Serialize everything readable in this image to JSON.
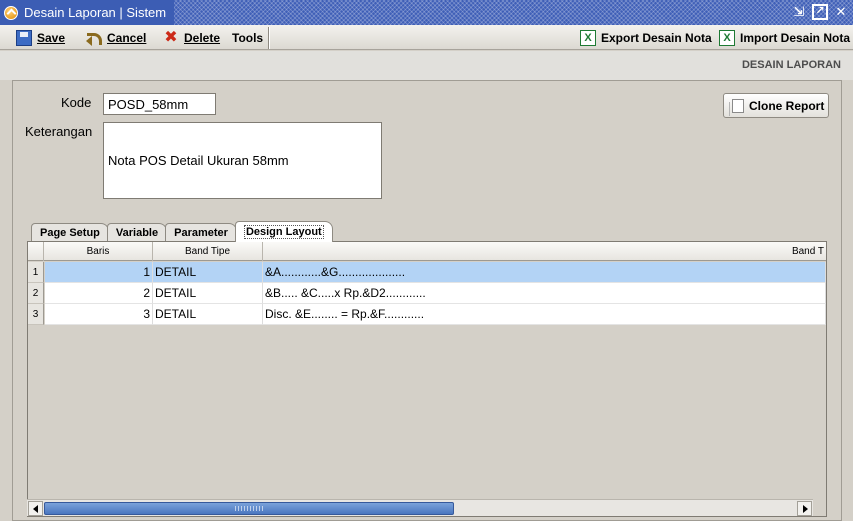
{
  "window": {
    "title": "Desain Laporan | Sistem",
    "icons": [
      "app-logo-icon",
      "minimize-icon",
      "maximize-icon",
      "close-icon"
    ]
  },
  "toolbar": {
    "save": "Save",
    "cancel": "Cancel",
    "delete": "Delete",
    "tools": "Tools",
    "export": "Export Desain Nota",
    "import": "Import Desain Nota"
  },
  "section_title": "DESAIN LAPORAN",
  "form": {
    "kode_label": "Kode",
    "kode_value": "POSD_58mm",
    "keterangan_label": "Keterangan",
    "keterangan_value": "Nota POS Detail Ukuran 58mm",
    "clone_button": "Clone Report"
  },
  "tabs": [
    {
      "label": "Page Setup",
      "active": false
    },
    {
      "label": "Variable",
      "active": false
    },
    {
      "label": "Parameter",
      "active": false
    },
    {
      "label": "Design Layout",
      "active": true
    }
  ],
  "grid": {
    "columns": [
      "Baris",
      "Band Tipe",
      "Band T"
    ],
    "rows": [
      {
        "num": "1",
        "baris": "1",
        "band_tipe": "DETAIL",
        "band_text": "&A............&G....................",
        "selected": true
      },
      {
        "num": "2",
        "baris": "2",
        "band_tipe": "DETAIL",
        "band_text": "&B..... &C.....x Rp.&D2............",
        "selected": false
      },
      {
        "num": "3",
        "baris": "3",
        "band_tipe": "DETAIL",
        "band_text": "Disc. &E........ = Rp.&F............",
        "selected": false
      }
    ]
  },
  "colors": {
    "title_bar": "#3f5fb7",
    "selected_row": "#b3d3f5",
    "scroll_thumb": "#4a76bf"
  }
}
